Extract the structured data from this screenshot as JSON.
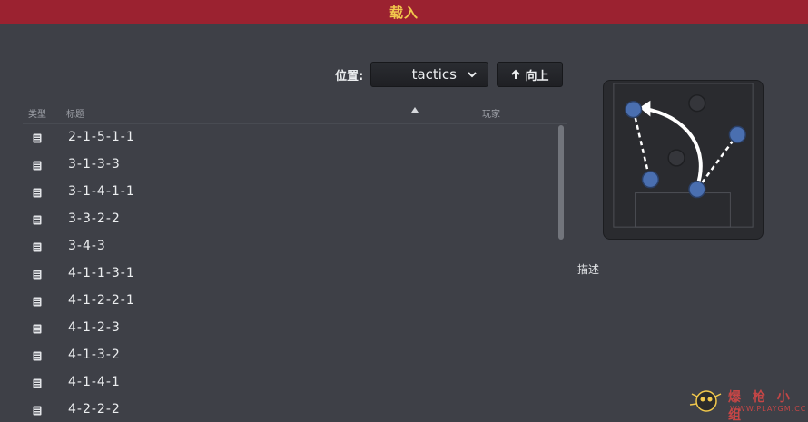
{
  "window": {
    "title": "载入"
  },
  "location": {
    "label": "位置:",
    "value": "tactics",
    "up_label": "向上"
  },
  "columns": {
    "type": "类型",
    "title": "标题",
    "player": "玩家"
  },
  "files": [
    "2-1-5-1-1",
    "3-1-3-3",
    "3-1-4-1-1",
    "3-3-2-2",
    "3-4-3",
    "4-1-1-3-1",
    "4-1-2-2-1",
    "4-1-2-3",
    "4-1-3-2",
    "4-1-4-1",
    "4-2-2-2"
  ],
  "preview": {
    "description_label": "描述"
  },
  "watermark": {
    "text": "爆 枪 小 组",
    "url": "WWW.PLAYGM.CC"
  },
  "colors": {
    "titlebar": "#9b2230",
    "title_text": "#f2c94c",
    "background": "#3e4047",
    "player_blue": "#4a6fb0",
    "player_dark": "#35363b"
  }
}
